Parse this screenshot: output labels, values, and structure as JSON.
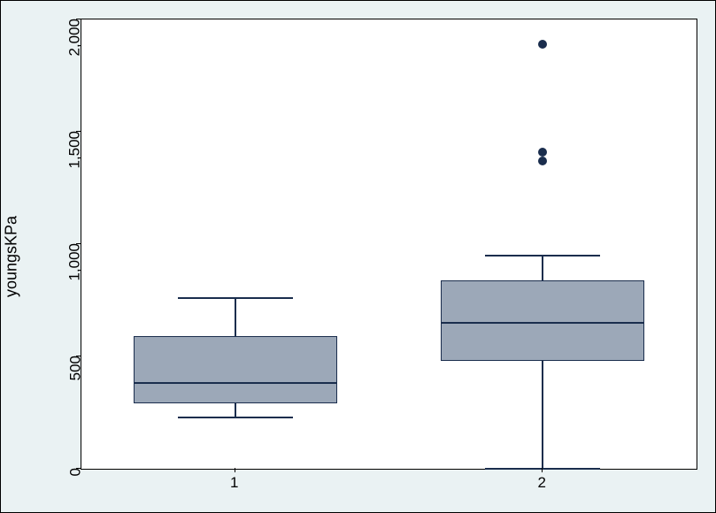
{
  "chart_data": {
    "type": "box",
    "ylabel": "youngsKPa",
    "y_ticks": [
      0,
      500,
      1000,
      1500,
      2000
    ],
    "y_tick_labels": [
      "0",
      "500",
      "1,000",
      "1,500",
      "2,000"
    ],
    "ylim": [
      0,
      2000
    ],
    "categories": [
      "1",
      "2"
    ],
    "series": [
      {
        "category": "1",
        "min": 230,
        "q1": 290,
        "median": 380,
        "q3": 590,
        "max": 760,
        "outliers": []
      },
      {
        "category": "2",
        "min": 0,
        "q1": 480,
        "median": 650,
        "q3": 840,
        "max": 950,
        "outliers": [
          1370,
          1410,
          1890
        ]
      }
    ]
  }
}
